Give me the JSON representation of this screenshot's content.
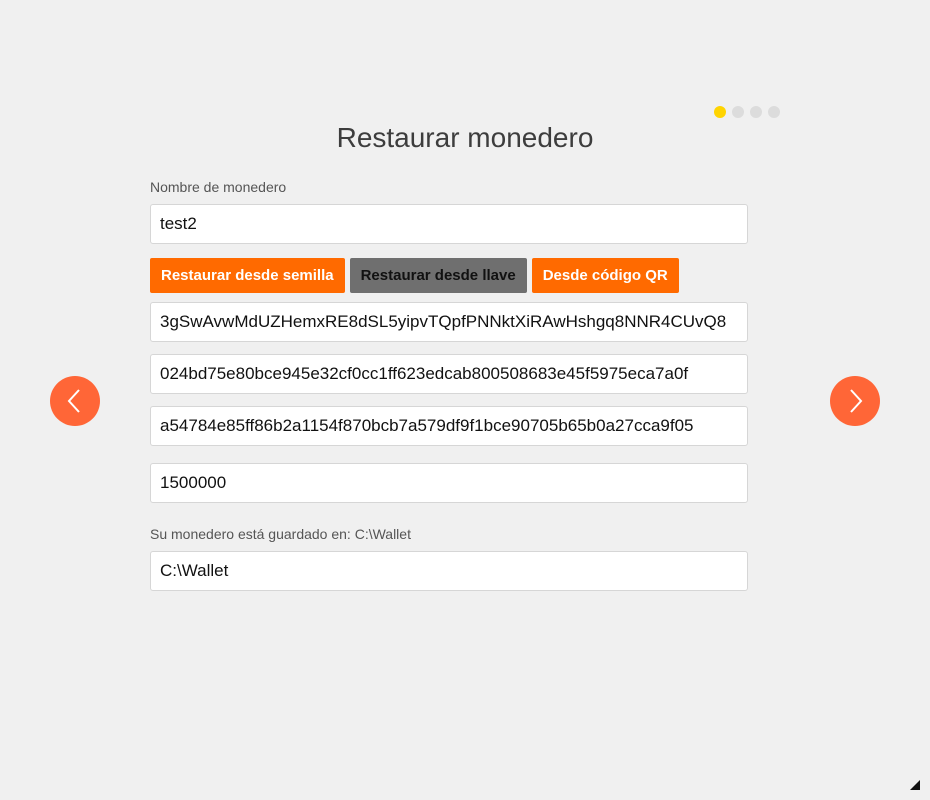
{
  "header": {
    "title": "Restaurar monedero",
    "progress": {
      "total_steps": 4,
      "current_step": 1,
      "active_color": "#ffd400"
    }
  },
  "wallet_name": {
    "label": "Nombre de monedero",
    "value": "test2"
  },
  "restore_options": {
    "from_seed": "Restaurar desde semilla",
    "from_key": "Restaurar desde llave",
    "from_qr": "Desde código QR",
    "selected": "from_key"
  },
  "key_fields": {
    "address": "3gSwAvwMdUZHemxRE8dSL5yipvTQpfPNNktXiRAwHshgq8NNR4CUvQ8",
    "view_key": "024bd75e80bce945e32cf0cc1ff623edcab800508683e45f5975eca7a0f",
    "spend_key": "a54784e85ff86b2a1154f870bcb7a579df9f1bce90705b65b0a27cca9f05",
    "restore_height": "1500000"
  },
  "location": {
    "label": "Su monedero está guardado en: C:\\Wallet",
    "value": "C:\\Wallet"
  },
  "navigation": {
    "prev_icon": "chevron-left-icon",
    "next_icon": "chevron-right-icon",
    "accent_color": "#ff6637"
  },
  "colors": {
    "button_orange": "#ff6a00",
    "button_selected": "#6f6f6f",
    "background": "#f0f0f0"
  }
}
